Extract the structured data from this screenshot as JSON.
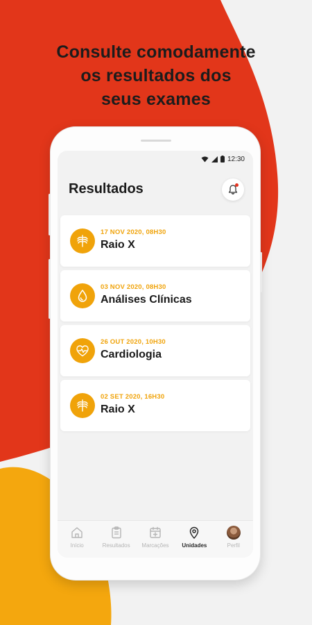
{
  "promo": {
    "line1": "Consulte comodamente",
    "line2": "os resultados dos",
    "line3": "seus exames"
  },
  "colors": {
    "red_blob": "#e2361a",
    "yellow_blob": "#f4a70e",
    "accent": "#f0a30a",
    "notification_dot": "#e53320"
  },
  "status_bar": {
    "time": "12:30"
  },
  "header": {
    "title": "Resultados",
    "notification_icon": "bell-icon"
  },
  "results": [
    {
      "date": "17 NOV 2020, 08H30",
      "title": "Raio X",
      "icon": "xray-ribcage-icon"
    },
    {
      "date": "03 NOV 2020, 08H30",
      "title": "Análises Clínicas",
      "icon": "blood-drop-icon"
    },
    {
      "date": "26 OUT 2020, 10H30",
      "title": "Cardiologia",
      "icon": "heart-pulse-icon"
    },
    {
      "date": "02 SET 2020, 16H30",
      "title": "Raio X",
      "icon": "xray-ribcage-icon"
    }
  ],
  "nav": [
    {
      "label": "Início",
      "icon": "home-icon",
      "active": false
    },
    {
      "label": "Resultados",
      "icon": "clipboard-icon",
      "active": false
    },
    {
      "label": "Marcações",
      "icon": "calendar-plus-icon",
      "active": false
    },
    {
      "label": "Unidades",
      "icon": "location-pin-icon",
      "active": true
    },
    {
      "label": "Perfil",
      "icon": "avatar",
      "active": false
    }
  ]
}
